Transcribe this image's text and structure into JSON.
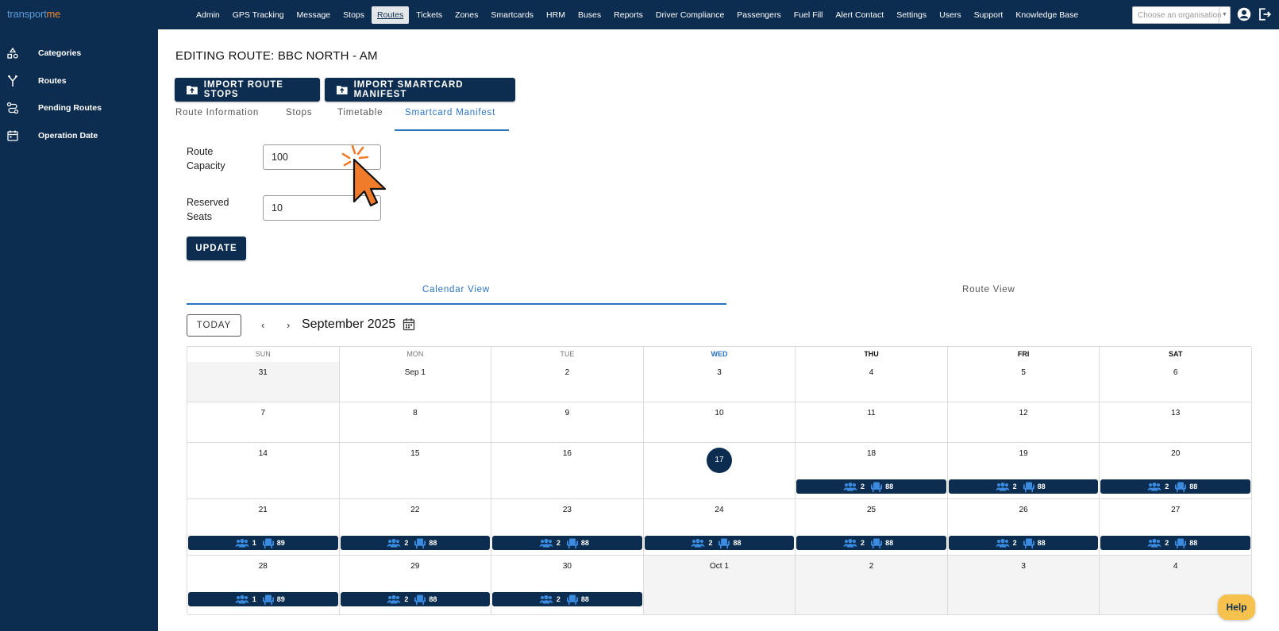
{
  "app": {
    "logo_part1": "transport",
    "logo_part2": "me"
  },
  "nav": {
    "items": [
      "Admin",
      "GPS Tracking",
      "Message",
      "Stops",
      "Routes",
      "Tickets",
      "Zones",
      "Smartcards",
      "HRM",
      "Buses",
      "Reports",
      "Driver Compliance",
      "Passengers",
      "Fuel Fill",
      "Alert Contact",
      "Settings",
      "Users",
      "Support",
      "Knowledge Base"
    ],
    "active": "Routes",
    "org_placeholder": "Choose an organisation"
  },
  "sidebar": {
    "items": [
      {
        "label": "Categories",
        "icon": "categories-icon"
      },
      {
        "label": "Routes",
        "icon": "routes-icon"
      },
      {
        "label": "Pending Routes",
        "icon": "pending-routes-icon"
      },
      {
        "label": "Operation Date",
        "icon": "calendar-icon"
      }
    ]
  },
  "page": {
    "title": "EDITING ROUTE: BBC NORTH - AM",
    "import_stops_label": "IMPORT ROUTE STOPS",
    "import_manifest_label": "IMPORT SMARTCARD MANIFEST"
  },
  "tabs": {
    "items": [
      "Route Information",
      "Stops",
      "Timetable",
      "Smartcard Manifest"
    ],
    "active": "Smartcard Manifest"
  },
  "form": {
    "capacity_label_line1": "Route",
    "capacity_label_line2": "Capacity",
    "capacity_value": "100",
    "reserved_label_line1": "Reserved",
    "reserved_label_line2": "Seats",
    "reserved_value": "10",
    "update_label": "UPDATE"
  },
  "views": {
    "calendar_label": "Calendar View",
    "route_label": "Route View",
    "active": "Calendar View"
  },
  "calendar": {
    "today_label": "TODAY",
    "prev_label": "‹",
    "next_label": "›",
    "month_label": "September 2025",
    "weekdays": [
      "SUN",
      "MON",
      "TUE",
      "WED",
      "THU",
      "FRI",
      "SAT"
    ],
    "today_weekday": "WED",
    "weeks": [
      [
        {
          "label": "31",
          "outside": true
        },
        {
          "label": "Sep 1"
        },
        {
          "label": "2"
        },
        {
          "label": "3"
        },
        {
          "label": "4"
        },
        {
          "label": "5"
        },
        {
          "label": "6"
        }
      ],
      [
        {
          "label": "7"
        },
        {
          "label": "8"
        },
        {
          "label": "9"
        },
        {
          "label": "10"
        },
        {
          "label": "11"
        },
        {
          "label": "12"
        },
        {
          "label": "13"
        }
      ],
      [
        {
          "label": "14"
        },
        {
          "label": "15"
        },
        {
          "label": "16"
        },
        {
          "label": "17",
          "today": true
        },
        {
          "label": "18",
          "passengers": "2",
          "seats": "88"
        },
        {
          "label": "19",
          "passengers": "2",
          "seats": "88"
        },
        {
          "label": "20",
          "passengers": "2",
          "seats": "88"
        }
      ],
      [
        {
          "label": "21",
          "passengers": "1",
          "seats": "89"
        },
        {
          "label": "22",
          "passengers": "2",
          "seats": "88"
        },
        {
          "label": "23",
          "passengers": "2",
          "seats": "88"
        },
        {
          "label": "24",
          "passengers": "2",
          "seats": "88"
        },
        {
          "label": "25",
          "passengers": "2",
          "seats": "88"
        },
        {
          "label": "26",
          "passengers": "2",
          "seats": "88"
        },
        {
          "label": "27",
          "passengers": "2",
          "seats": "88"
        }
      ],
      [
        {
          "label": "28",
          "passengers": "1",
          "seats": "89"
        },
        {
          "label": "29",
          "passengers": "2",
          "seats": "88"
        },
        {
          "label": "30",
          "passengers": "2",
          "seats": "88"
        },
        {
          "label": "Oct 1",
          "outside": true
        },
        {
          "label": "2",
          "outside": true
        },
        {
          "label": "3",
          "outside": true
        },
        {
          "label": "4",
          "outside": true
        }
      ]
    ]
  },
  "help": {
    "label": "Help"
  },
  "colors": {
    "navy": "#0c2d4f",
    "accent_blue": "#2a73c0",
    "help_yellow": "#f7c14d",
    "cursor_orange": "#f07b2a"
  }
}
